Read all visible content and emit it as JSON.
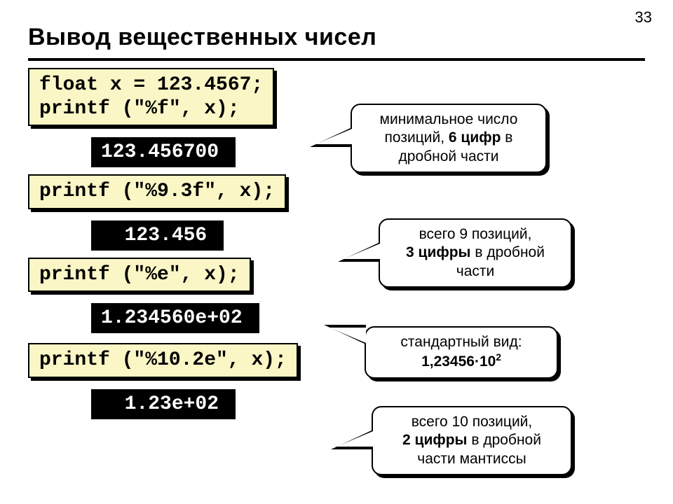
{
  "page_number": "33",
  "title": "Вывод вещественных чисел",
  "code1_line1": "float x = 123.4567;",
  "code1_line2": "printf (\"%f\", x);",
  "output1": "123.456700",
  "note1_l1": "минимальное число",
  "note1_l2_a": "позиций, ",
  "note1_l2_b": "6 цифр",
  "note1_l2_c": " в",
  "note1_l3": "дробной части",
  "code2": "printf (\"%9.3f\", x);",
  "output2": "  123.456",
  "note2_l1": "всего 9 позиций,",
  "note2_l2_a": "3 цифры",
  "note2_l2_b": " в дробной",
  "note2_l3": "части",
  "code3": "printf (\"%e\", x);",
  "output3": "1.234560e+02",
  "note3_l1": "стандартный вид:",
  "note3_l2_a": "1,23456·10",
  "note3_l2_sup": "2",
  "code4": "printf (\"%10.2e\", x);",
  "output4": "  1.23e+02",
  "note4_l1": "всего 10 позиций,",
  "note4_l2_a": "2 цифры",
  "note4_l2_b": " в дробной",
  "note4_l3": "части мантиссы"
}
